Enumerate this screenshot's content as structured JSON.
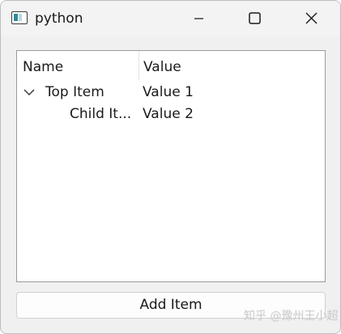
{
  "window": {
    "title": "python",
    "icon": "python-app-icon"
  },
  "tree": {
    "headers": [
      "Name",
      "Value"
    ],
    "rows": [
      {
        "name": "Top Item",
        "value": "Value 1",
        "expanded": true,
        "level": 0
      },
      {
        "name": "Child It...",
        "value": "Value 2",
        "level": 1
      }
    ]
  },
  "add_button": {
    "label": "Add Item"
  },
  "watermark": {
    "text": "知乎 @豫州王小超"
  }
}
